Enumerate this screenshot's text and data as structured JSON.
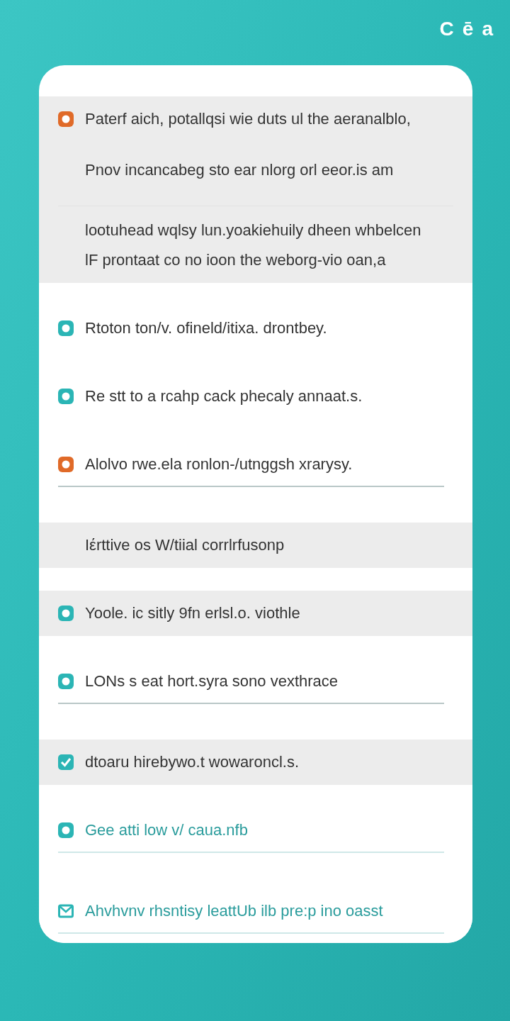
{
  "header": {
    "glyphs": [
      "C",
      "ē",
      "a"
    ]
  },
  "items": [
    {
      "kind": "ring",
      "color": "#e06a28",
      "band": true,
      "tinted": false,
      "underline": false,
      "text": "Paterf aich, potallqsi wie duts ul the aeranalblo,",
      "lines": [
        "Pnov incancabeg sto ear nlorg orl eeor.is am",
        "lootuhead wqlsy lun.yoakiehuily dheen whbelcen",
        "lF prontaat co no ioon the weborg-vio oan,a"
      ]
    },
    {
      "kind": "ring",
      "color": "#2bb5b5",
      "band": false,
      "tinted": false,
      "underline": false,
      "text": "Rtoton ton/v. ofineld/itixa. drontbey."
    },
    {
      "kind": "ring",
      "color": "#2bb5b5",
      "band": false,
      "tinted": false,
      "underline": false,
      "text": "Re stt to a rcahp cack phecaly annaat.s."
    },
    {
      "kind": "ring",
      "color": "#e06a28",
      "band": false,
      "tinted": false,
      "underline": true,
      "text": "Alolvo rwe.ela ronlon-/utnggsh xrarysy."
    },
    {
      "kind": "none",
      "band": true,
      "tinted": false,
      "underline": false,
      "text": "Iέrttive os W/tiial corrlrfusonp"
    },
    {
      "kind": "ring",
      "color": "#2bb5b5",
      "band": true,
      "tinted": false,
      "underline": false,
      "text": "Yoole. ic sitly 9fn erlsl.o. viothle"
    },
    {
      "kind": "ring",
      "color": "#2bb5b5",
      "band": false,
      "tinted": false,
      "underline": true,
      "text": "LONs s eat hort.syra sono vexthrace"
    },
    {
      "kind": "check",
      "color": "#2bb5b5",
      "band": true,
      "tinted": false,
      "underline": false,
      "text": "dtoaru hirebywo.t wowaroncl.s."
    },
    {
      "kind": "ring",
      "color": "#2bb5b5",
      "band": false,
      "tinted": true,
      "underline": true,
      "text": "Gee atti low v/ caua.nfb"
    },
    {
      "kind": "mail",
      "color": "#2bb5b5",
      "band": false,
      "tinted": true,
      "underline": true,
      "text": "Ahvhvnv rhsntisy leattUb ilb pre:p ino oasst"
    }
  ]
}
